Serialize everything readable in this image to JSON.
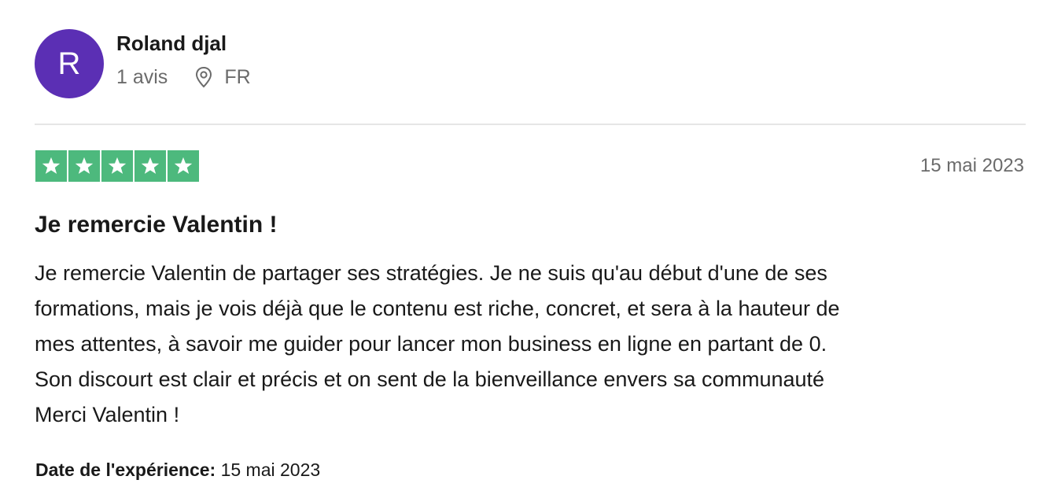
{
  "consumer": {
    "avatar_initial": "R",
    "avatar_color": "#5b2fb4",
    "name": "Roland djal",
    "review_count": "1 avis",
    "location_icon": "location-pin-icon",
    "country": "FR"
  },
  "review": {
    "rating": 5,
    "rating_max": 5,
    "star_icon": "star-icon",
    "star_color": "#4db97d",
    "date": "15 mai 2023",
    "title": "Je remercie Valentin !",
    "lines": [
      "Je remercie Valentin de partager ses stratégies. Je ne suis qu'au début d'une de ses",
      "formations, mais je vois déjà que le contenu est riche, concret, et sera à la hauteur de",
      "mes attentes, à savoir me guider pour lancer mon business en ligne en partant de 0.",
      "Son discourt est clair et précis et on sent de la bienveillance envers sa communauté",
      "Merci Valentin !"
    ],
    "experience_label": "Date de l'expérience:",
    "experience_date": "15 mai 2023"
  }
}
